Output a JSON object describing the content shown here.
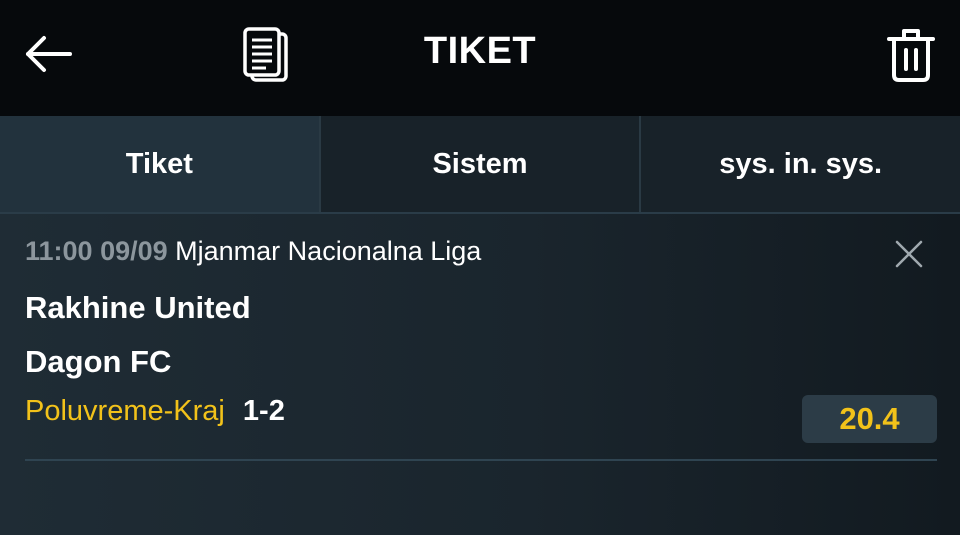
{
  "header": {
    "title": "TIKET",
    "back_icon": "arrow-left-icon",
    "ticket_icon": "document-icon",
    "delete_icon": "trash-icon"
  },
  "tabs": [
    {
      "label": "Tiket",
      "active": true
    },
    {
      "label": "Sistem",
      "active": false
    },
    {
      "label": "sys. in. sys.",
      "active": false
    }
  ],
  "bet": {
    "time": "11:00 09/09",
    "league": "Mjanmar Nacionalna Liga",
    "home_team": "Rakhine United",
    "away_team": "Dagon FC",
    "market": "Poluvreme-Kraj",
    "pick": "1-2",
    "odd": "20.4"
  },
  "colors": {
    "accent": "#f2c21a",
    "header_bg": "#06090c",
    "tab_active_bg": "#22323d",
    "content_bg": "#1a252d"
  }
}
